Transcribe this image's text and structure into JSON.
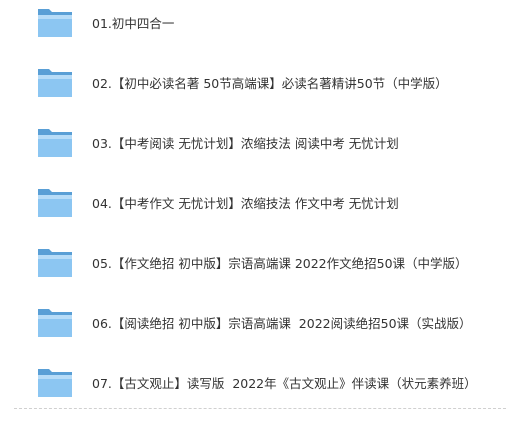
{
  "colors": {
    "folder_back": "#5a9fd6",
    "folder_front": "#8cc6f2",
    "folder_front_light": "#b7dcf8",
    "text": "#333333"
  },
  "folders": [
    {
      "name": "01.初中四合一",
      "icon": "folder-icon"
    },
    {
      "name": "02.【初中必读名著 50节高端课】必读名著精讲50节（中学版）",
      "icon": "folder-icon"
    },
    {
      "name": "03.【中考阅读 无忧计划】浓缩技法 阅读中考 无忧计划",
      "icon": "folder-icon"
    },
    {
      "name": "04.【中考作文 无忧计划】浓缩技法 作文中考 无忧计划",
      "icon": "folder-icon"
    },
    {
      "name": "05.【作文绝招 初中版】宗语高端课 2022作文绝招50课（中学版）",
      "icon": "folder-icon"
    },
    {
      "name": "06.【阅读绝招 初中版】宗语高端课  2022阅读绝招50课（实战版）",
      "icon": "folder-icon"
    },
    {
      "name": "07.【古文观止】读写版  2022年《古文观止》伴读课（状元素养班）",
      "icon": "folder-icon"
    }
  ]
}
